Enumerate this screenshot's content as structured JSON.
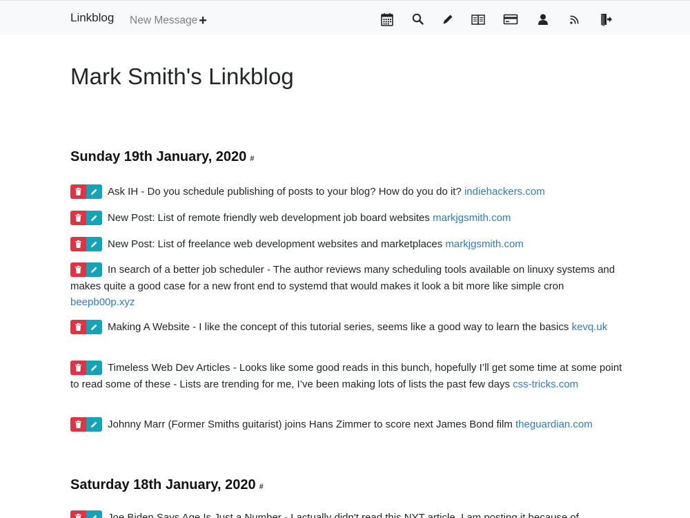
{
  "navbar": {
    "brand": "Linkblog",
    "new_message": "New Message",
    "new_message_plus": "+",
    "icons": [
      "calendar-icon",
      "search-icon",
      "pencil-icon",
      "book-icon",
      "credit-card-icon",
      "user-icon",
      "rss-icon",
      "logout-icon"
    ]
  },
  "page": {
    "title": "Mark Smith's Linkblog"
  },
  "days": [
    {
      "heading": "Sunday 19th January, 2020",
      "hash": "#",
      "entries": [
        {
          "text": "Ask IH - Do you schedule publishing of posts to your blog? How do you do it?",
          "link": "indiehackers.com"
        },
        {
          "text": "New Post: List of remote friendly web development job board websites",
          "link": "markjgsmith.com"
        },
        {
          "text": "New Post: List of freelance web development websites and marketplaces",
          "link": "markjgsmith.com"
        },
        {
          "text": "In search of a better job scheduler - The author reviews many scheduling tools available on linuxy systems and makes quite a good case for a new front end to systemd that would makes it look a bit more like simple cron",
          "link": "beepb00p.xyz"
        },
        {
          "text": "Making A Website - I like the concept of this tutorial series, seems like a good way to learn the basics",
          "link": "kevq.uk"
        },
        {
          "text": "Timeless Web Dev Articles - Looks like some good reads in this bunch, hopefully I’ll get some time at some point to read some of these - Lists are trending for me, I’ve been making lots of lists the past few days",
          "link": "css-tricks.com"
        },
        {
          "text": "Johnny Marr (Former Smiths guitarist) joins Hans Zimmer to score next James Bond film",
          "link": "theguardian.com"
        }
      ]
    },
    {
      "heading": "Saturday 18th January, 2020",
      "hash": "#",
      "entries": [
        {
          "text": "Joe Biden Says Age Is Just a Number - I actually didn't read this NYT article, I am posting it because of",
          "link": ""
        }
      ]
    }
  ]
}
